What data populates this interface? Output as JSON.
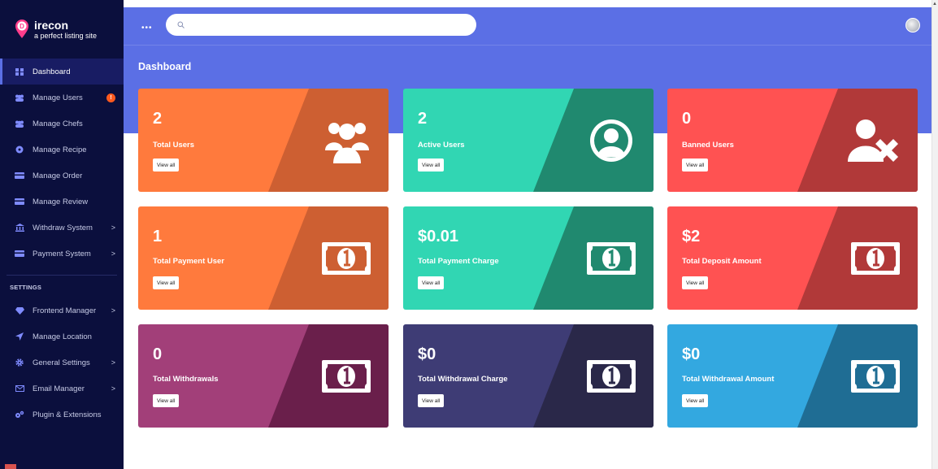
{
  "brand": {
    "name": "irecon",
    "letter": "D",
    "tagline": "a perfect listing site"
  },
  "sidebar": {
    "items": [
      {
        "label": "Dashboard",
        "icon": "dashboard-icon",
        "active": true
      },
      {
        "label": "Manage Users",
        "icon": "users-icon",
        "badge": "!"
      },
      {
        "label": "Manage Chefs",
        "icon": "chefs-icon"
      },
      {
        "label": "Manage Recipe",
        "icon": "recipe-icon"
      },
      {
        "label": "Manage Order",
        "icon": "card-icon"
      },
      {
        "label": "Manage Review",
        "icon": "card-icon"
      },
      {
        "label": "Withdraw System",
        "icon": "bank-icon",
        "chevron": ">"
      },
      {
        "label": "Payment System",
        "icon": "card-icon",
        "chevron": ">"
      }
    ],
    "section_title": "SETTINGS",
    "settings_items": [
      {
        "label": "Frontend Manager",
        "icon": "diamond-icon",
        "chevron": ">"
      },
      {
        "label": "Manage Location",
        "icon": "location-arrow-icon"
      },
      {
        "label": "General Settings",
        "icon": "gear-icon",
        "chevron": ">"
      },
      {
        "label": "Email Manager",
        "icon": "envelope-icon",
        "chevron": ">"
      },
      {
        "label": "Plugin & Extensions",
        "icon": "cogs-icon"
      }
    ]
  },
  "header": {
    "menu_icon": "dots-icon",
    "search_placeholder": "",
    "search_icon": "search-icon"
  },
  "page_title": "Dashboard",
  "cards": [
    {
      "value": "2",
      "label": "Total Users",
      "button": "View all",
      "icon": "users-group-icon",
      "color": "#ff7a3d",
      "dark": "#cd5f32"
    },
    {
      "value": "2",
      "label": "Active Users",
      "button": "View all",
      "icon": "user-circle-icon",
      "color": "#31d6b3",
      "dark": "#20896f"
    },
    {
      "value": "0",
      "label": "Banned Users",
      "button": "View all",
      "icon": "user-ban-icon",
      "color": "#ff5252",
      "dark": "#b13939"
    },
    {
      "value": "1",
      "label": "Total Payment User",
      "button": "View all",
      "icon": "money-bill-icon",
      "color": "#ff7a3d",
      "dark": "#cd5f32"
    },
    {
      "value": "$0.01",
      "label": "Total Payment Charge",
      "button": "View all",
      "icon": "money-bill-icon",
      "color": "#31d6b3",
      "dark": "#20896f"
    },
    {
      "value": "$2",
      "label": "Total Deposit Amount",
      "button": "View all",
      "icon": "money-bill-icon",
      "color": "#ff5252",
      "dark": "#b13939"
    },
    {
      "value": "0",
      "label": "Total Withdrawals",
      "button": "View all",
      "icon": "money-bill-icon",
      "color": "#a23f79",
      "dark": "#6a1f4b"
    },
    {
      "value": "$0",
      "label": "Total Withdrawal Charge",
      "button": "View all",
      "icon": "money-bill-icon",
      "color": "#3e3c75",
      "dark": "#2a2849"
    },
    {
      "value": "$0",
      "label": "Total Withdrawal Amount",
      "button": "View all",
      "icon": "money-bill-icon",
      "color": "#33a8e0",
      "dark": "#1f6d94"
    }
  ]
}
